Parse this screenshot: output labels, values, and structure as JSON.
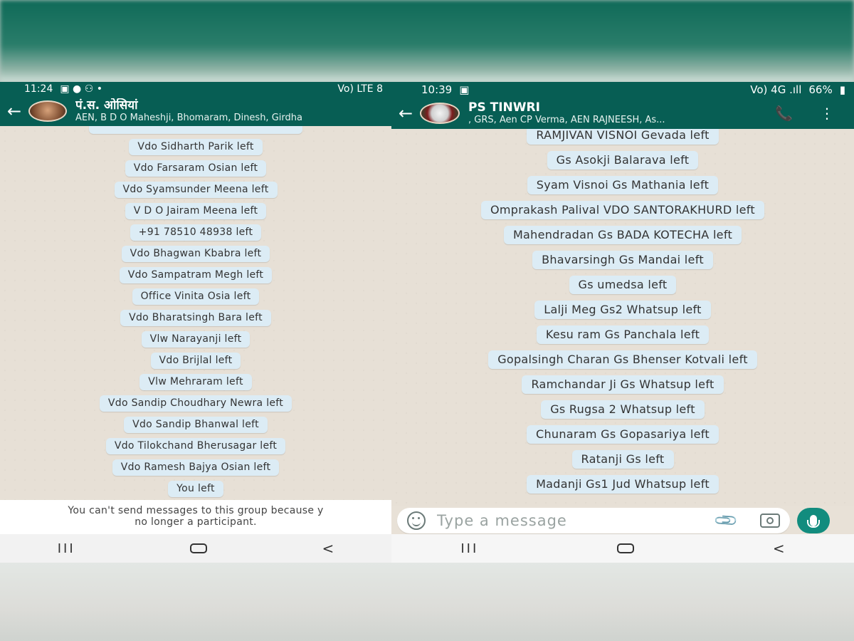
{
  "left": {
    "status": {
      "time": "11:24",
      "right": "Vo) LTE 8"
    },
    "header": {
      "back": "←",
      "title": "पं.स. ओसियां",
      "subtitle": "AEN, B D O Maheshji, Bhomaram, Dinesh, Girdha"
    },
    "messages": [
      "Vdo Sidharth Parik left",
      "Vdo Farsaram Osian left",
      "Vdo Syamsunder Meena left",
      "V D O Jairam Meena left",
      "+91 78510 48938 left",
      "Vdo Bhagwan Kbabra left",
      "Vdo Sampatram Megh left",
      "Office Vinita Osia left",
      "Vdo Bharatsingh Bara left",
      "Vlw Narayanji left",
      "Vdo Brijlal left",
      "Vlw Mehraram left",
      "Vdo Sandip Choudhary Newra left",
      "Vdo Sandip Bhanwal left",
      "Vdo Tilokchand Bherusagar left",
      "Vdo Ramesh Bajya Osian left",
      "You left"
    ],
    "notice_line1": "You can't send messages to this group because y",
    "notice_line2": "no longer a participant.",
    "nav": {
      "recent": "III",
      "back": "<"
    }
  },
  "right": {
    "status": {
      "time": "10:39",
      "battery": "66%",
      "signal": "Vo) 4G .ıll"
    },
    "header": {
      "back": "←",
      "title": "PS TINWRI",
      "subtitle": ", GRS, Aen CP Verma, AEN RAJNEESH, As..."
    },
    "messages": [
      "RAMJIVAN VISNOI Gevada left",
      "Gs Asokji Balarava left",
      "Syam Visnoi Gs Mathania left",
      "Omprakash Palival VDO SANTORAKHURD left",
      "Mahendradan Gs BADA KOTECHA left",
      "Bhavarsingh Gs Mandai left",
      "Gs umedsa left",
      "Lalji Meg Gs2 Whatsup left",
      "Kesu ram Gs Panchala left",
      "Gopalsingh Charan Gs Bhenser Kotvali left",
      "Ramchandar Ji Gs Whatsup left",
      "Gs Rugsa 2 Whatsup left",
      "Chunaram Gs Gopasariya left",
      "Ratanji Gs left",
      "Madanji Gs1 Jud Whatsup left"
    ],
    "composer_placeholder": "Type a message",
    "nav": {
      "recent": "III",
      "back": "<"
    }
  }
}
